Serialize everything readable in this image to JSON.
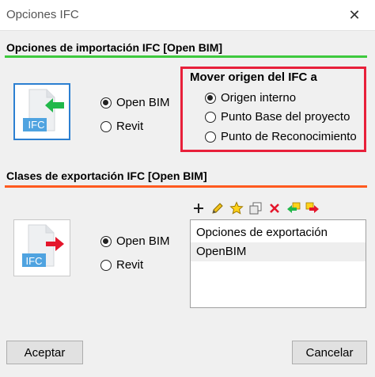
{
  "window": {
    "title": "Opciones IFC"
  },
  "import": {
    "header": "Opciones de importación IFC [Open BIM]",
    "tile_label": "IFC",
    "options": [
      "Open BIM",
      "Revit"
    ],
    "selected": "Open BIM"
  },
  "origin": {
    "title": "Mover origen del IFC a",
    "options": [
      "Origen interno",
      "Punto Base del proyecto",
      "Punto de Reconocimiento"
    ],
    "selected": "Origen interno"
  },
  "export": {
    "header": "Clases de exportación IFC [Open BIM]",
    "tile_label": "IFC",
    "options": [
      "Open BIM",
      "Revit"
    ],
    "selected": "Open BIM",
    "list": [
      "Opciones de exportación",
      "OpenBIM"
    ]
  },
  "toolbar": {
    "icons": [
      "plus-icon",
      "pencil-icon",
      "star-icon",
      "duplicate-icon",
      "delete-icon",
      "import-icon",
      "export-icon"
    ]
  },
  "buttons": {
    "accept": "Aceptar",
    "cancel": "Cancelar"
  },
  "colors": {
    "import_rule": "#3ec93e",
    "export_rule": "#ff5a1f",
    "highlight_box": "#e8203a",
    "tile_selected": "#2c7fd1"
  }
}
